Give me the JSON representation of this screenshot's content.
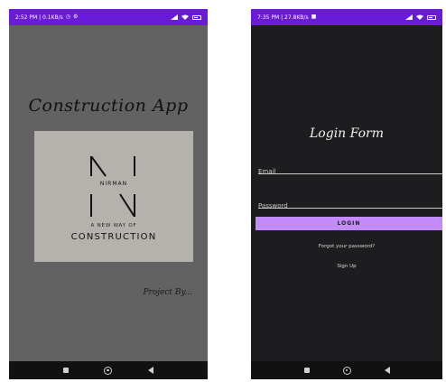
{
  "screen1": {
    "status": {
      "time": "2:52 PM | 0.1KB/s"
    },
    "app_title": "Construction App",
    "logo": {
      "name": "NIRMAN",
      "tagline": "A NEW WAY OF",
      "subtitle": "CONSTRUCTION"
    },
    "project_by": "Project By..."
  },
  "screen2": {
    "status": {
      "time": "7:35 PM | 27.8KB/s"
    },
    "login_title": "Login Form",
    "email_placeholder": "Email",
    "password_placeholder": "Password",
    "login_button": "LOGIN",
    "forgot_password": "Forgot your password?",
    "sign_up": "Sign Up"
  },
  "colors": {
    "status_bar": "#6a1bd8",
    "splash_bg": "#626262",
    "login_bg": "#1d1d1f",
    "accent_button": "#c48cfa",
    "logo_box": "#b5b2ae"
  }
}
